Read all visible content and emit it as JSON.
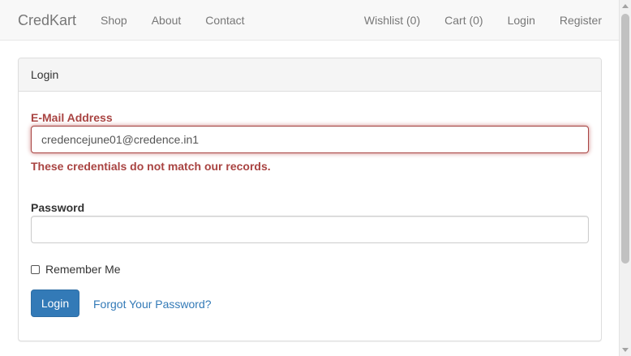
{
  "navbar": {
    "brand": "CredKart",
    "left_links": [
      "Shop",
      "About",
      "Contact"
    ],
    "right_links": [
      "Wishlist (0)",
      "Cart (0)",
      "Login",
      "Register"
    ]
  },
  "panel": {
    "heading": "Login",
    "email": {
      "label": "E-Mail Address",
      "value": "credencejune01@credence.in1",
      "error": "These credentials do not match our records."
    },
    "password": {
      "label": "Password",
      "value": ""
    },
    "remember_label": "Remember Me",
    "remember_checked": false,
    "submit_label": "Login",
    "forgot_label": "Forgot Your Password?"
  },
  "colors": {
    "primary": "#337ab7",
    "error": "#a94442",
    "navbar_bg": "#f8f8f8"
  }
}
